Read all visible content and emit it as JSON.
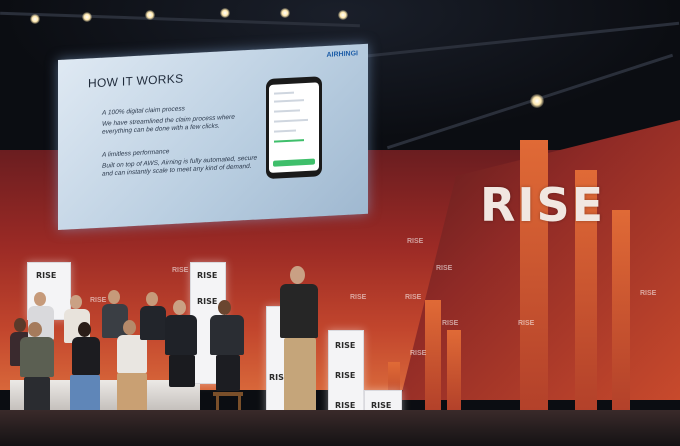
{
  "slide": {
    "title": "HOW IT WORKS",
    "logo": "AIRHINGI",
    "point1_title": "A 100% digital claim process",
    "point1_body": "We have streamlined the claim process where everything can be done with a few clicks.",
    "point2_title": "A limitless performance",
    "point2_body": "Built on top of AWS, Airning is fully automated, secure and can instantly scale to meet any kind of demand."
  },
  "backdrop": {
    "big_label": "RISE",
    "small_label": "RISE"
  },
  "cubes": {
    "label": "RISE"
  },
  "colors": {
    "wall": "#9b2a25",
    "accent": "#d8673a",
    "cube": "#f4f4f6",
    "screen": "#b8cde0"
  }
}
